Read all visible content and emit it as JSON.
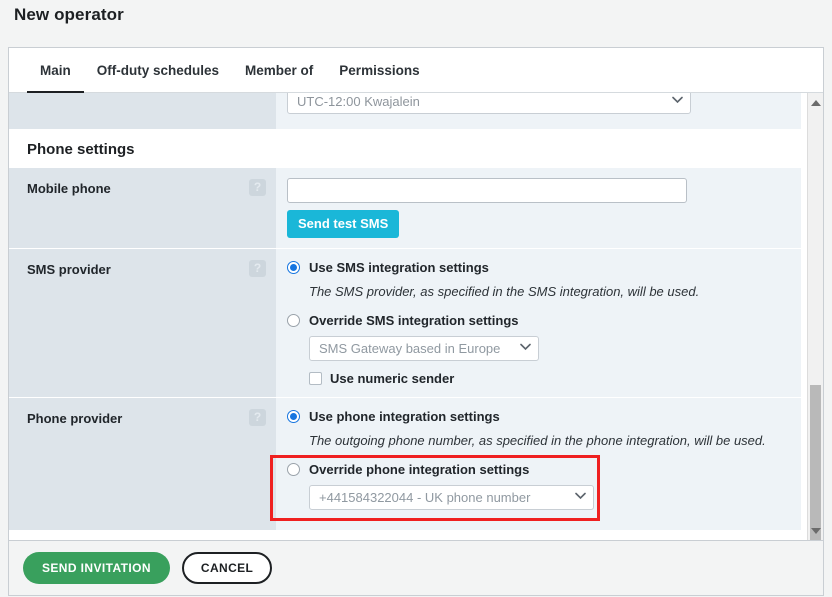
{
  "page": {
    "title": "New operator"
  },
  "tabs": [
    {
      "label": "Main",
      "active": true
    },
    {
      "label": "Off-duty schedules",
      "active": false
    },
    {
      "label": "Member of",
      "active": false
    },
    {
      "label": "Permissions",
      "active": false
    }
  ],
  "timezone_row": {
    "selected": "UTC-12:00 Kwajalein"
  },
  "phone_settings": {
    "heading": "Phone settings",
    "mobile_phone": {
      "label": "Mobile phone",
      "help": "?",
      "input_value": "",
      "input_placeholder": "",
      "send_test_sms_label": "Send test SMS"
    },
    "sms_provider": {
      "label": "SMS provider",
      "help": "?",
      "option_use": "Use SMS integration settings",
      "option_use_hint": "The SMS provider, as specified in the SMS integration, will be used.",
      "option_override": "Override SMS integration settings",
      "gateway_selected": "SMS Gateway based in Europe",
      "numeric_sender_label": "Use numeric sender",
      "selected_option": "use"
    },
    "phone_provider": {
      "label": "Phone provider",
      "help": "?",
      "option_use": "Use phone integration settings",
      "option_use_hint": "The outgoing phone number, as specified in the phone integration, will be used.",
      "option_override": "Override phone integration settings",
      "number_selected": "+441584322044 - UK phone number",
      "selected_option": "use"
    }
  },
  "footer": {
    "send_invitation_label": "SEND INVITATION",
    "cancel_label": "CANCEL"
  },
  "colors": {
    "accent_teal": "#1ab7d8",
    "accent_green": "#39a05d",
    "radio_blue": "#1675e0",
    "highlight_red": "#ef2020",
    "label_bg": "#dde4ea",
    "field_bg": "#eef3f7"
  },
  "icons": {
    "caret_down": "⌄",
    "help": "?"
  }
}
